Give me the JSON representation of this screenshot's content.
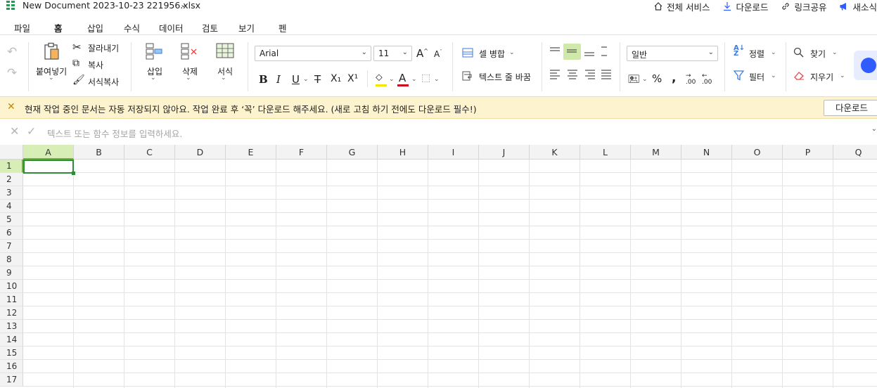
{
  "title_bar": {
    "doc_title": "New Document 2023-10-23 221956.xlsx",
    "actions": [
      {
        "label": "전체 서비스",
        "icon": "home-icon"
      },
      {
        "label": "다운로드",
        "icon": "download-icon"
      },
      {
        "label": "링크공유",
        "icon": "link-icon"
      },
      {
        "label": "새소식",
        "icon": "megaphone-icon"
      }
    ]
  },
  "menu": {
    "tabs": [
      "파일",
      "홈",
      "삽입",
      "수식",
      "데이터",
      "검토",
      "보기",
      "펜"
    ],
    "active": "홈"
  },
  "ribbon": {
    "paste": "붙여넣기",
    "cut": "잘라내기",
    "copy": "복사",
    "format_painter": "서식복사",
    "insert": "삽입",
    "delete": "삭제",
    "format": "서식",
    "font_name": "Arial",
    "font_size": "11",
    "merge_cells": "셀 병합",
    "wrap_text": "텍스트 줄 바꿈",
    "number_format": "일반",
    "sort": "정렬",
    "filter": "필터",
    "find": "찾기",
    "clear": "지우기",
    "bold": "B",
    "italic": "I",
    "underline": "U",
    "strike": "T",
    "subscript": "X₁",
    "superscript": "X¹",
    "percent": "%",
    "comma": ","
  },
  "notice": {
    "text": "현재 작업 중인 문서는 자동 저장되지 않아요. 작업 완료 후 ‘꼭’ 다운로드 해주세요. (새로 고침 하기 전에도 다운로드 필수!)",
    "button": "다운로드"
  },
  "formula_bar": {
    "placeholder": "텍스트 또는 함수 정보를 입력하세요."
  },
  "sheet": {
    "columns": [
      "A",
      "B",
      "C",
      "D",
      "E",
      "F",
      "G",
      "H",
      "I",
      "J",
      "K",
      "L",
      "M",
      "N",
      "O",
      "P",
      "Q"
    ],
    "rows": [
      "1",
      "2",
      "3",
      "4",
      "5",
      "6",
      "7",
      "8",
      "9",
      "10",
      "11",
      "12",
      "13",
      "14",
      "15",
      "16",
      "17"
    ],
    "selected_cell": "A1"
  },
  "colors": {
    "accent": "#1f9d55",
    "selection": "#2e8b3a",
    "header_selected": "#d7efb6",
    "notice_bg": "#fdf3cf"
  }
}
